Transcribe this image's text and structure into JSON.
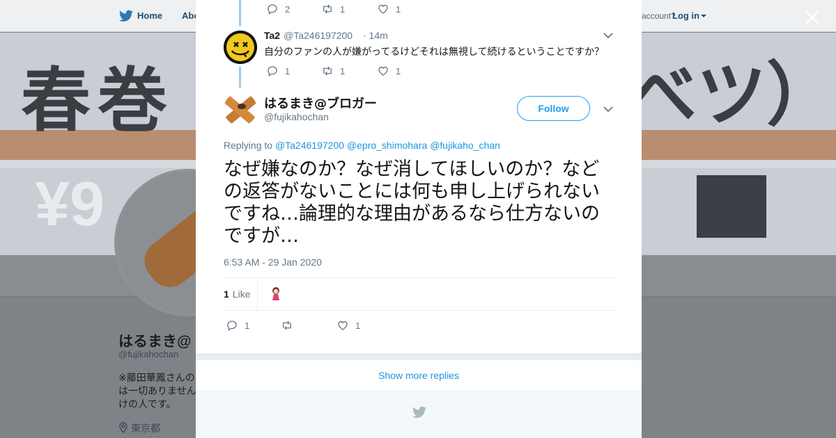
{
  "nav": {
    "home_label": "Home",
    "about_label": "Abo",
    "account_text": "account?",
    "login_label": "Log in"
  },
  "background_profile": {
    "banner_text_left": "春巻",
    "banner_text_right": "べツ）",
    "banner_price": "¥9",
    "name": "はるまき@",
    "handle": "@fujikahochan",
    "bio_lines": [
      "※藤田華鳳さんの",
      "は一切ありません",
      "けの人です。"
    ],
    "location": "東京都"
  },
  "colors": {
    "accent": "#1da1f2",
    "link": "#1b95e0",
    "thread_line": "#9bcbf0",
    "muted": "#657786"
  },
  "modal": {
    "prev_tweet_actions": {
      "replies": "2",
      "retweets": "1",
      "likes": "1"
    },
    "reply_tweet": {
      "name": "Ta2",
      "handle": "@Ta246197200",
      "time": "· 14m",
      "text": "自分のファンの人が嫌がってるけどそれは無視して続けるということですか？",
      "actions": {
        "replies": "1",
        "retweets": "1",
        "likes": "1"
      }
    },
    "main_tweet": {
      "name": "はるまき@ブロガー",
      "handle": "@fujikahochan",
      "follow_label": "Follow",
      "replying_prefix": "Replying to",
      "replying_to": [
        "@Ta246197200",
        "@epro_shimohara",
        "@fujikaho_chan"
      ],
      "text": "なぜ嫌なのか？なぜ消してほしいのか？などの返答がないことには何も申し上げられないですね…論理的な理由があるなら仕方ないのですが…",
      "timestamp": "6:53 AM - 29 Jan 2020",
      "like_count": "1",
      "like_word": "Like",
      "actions": {
        "replies": "1",
        "retweets": "",
        "likes": "1"
      }
    },
    "show_more_label": "Show more replies"
  },
  "icons": {
    "close": "close-icon",
    "reply": "reply-icon",
    "retweet": "retweet-icon",
    "like": "heart-icon",
    "more": "chevron-down-icon",
    "brand": "twitter-bird-icon"
  }
}
